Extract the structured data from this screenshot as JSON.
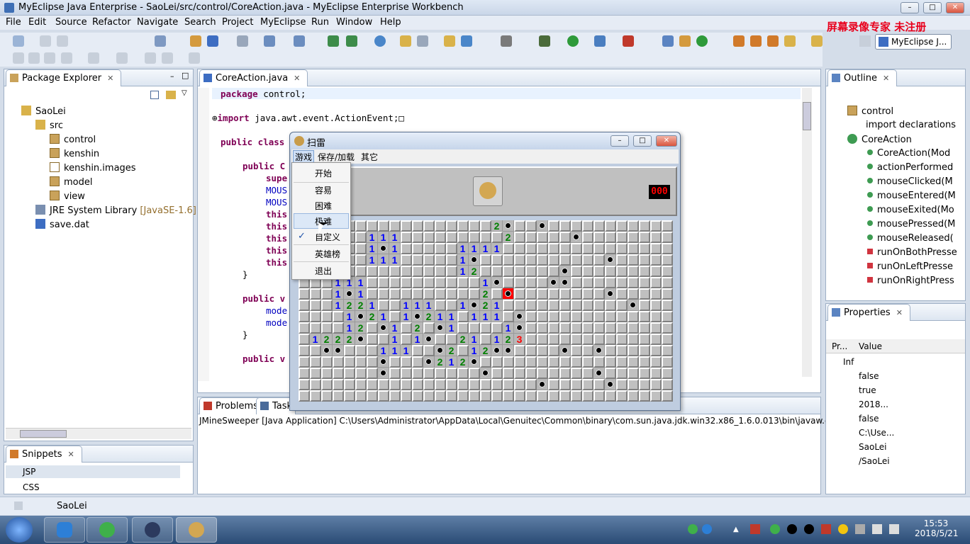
{
  "window": {
    "title": "MyEclipse Java Enterprise - SaoLei/src/control/CoreAction.java - MyEclipse Enterprise Workbench"
  },
  "watermark": "屏幕录像专家 未注册",
  "menubar": [
    "File",
    "Edit",
    "Source",
    "Refactor",
    "Navigate",
    "Search",
    "Project",
    "MyEclipse",
    "Run",
    "Window",
    "Help"
  ],
  "perspective": {
    "label": "MyEclipse J..."
  },
  "package_explorer": {
    "title": "Package Explorer",
    "project": "SaoLei",
    "src": "src",
    "packages": [
      "control",
      "kenshin",
      "kenshin.images",
      "model",
      "view"
    ],
    "jre": "JRE System Library",
    "jre_version": "[JavaSE-1.6]",
    "file": "save.dat"
  },
  "editor": {
    "tab": "CoreAction.java",
    "lines": {
      "package_kw": "package",
      "package_rest": " control;",
      "import_kw": "import",
      "import_rest": " java.awt.event.ActionEvent;",
      "class_kw": "public class",
      "ctor": "public C",
      "super_": "supe",
      "mous1": "MOUS",
      "mous2": "MOUS",
      "this1": "this",
      "this2": "this",
      "this3": "this",
      "this4": "this",
      "this5": "this",
      "brace1": "}",
      "pubv1": "public v",
      "mode1": "mode",
      "mode2": "mode",
      "brace2": "}",
      "pubv2": "public v"
    }
  },
  "outline": {
    "title": "Outline",
    "items": [
      "control",
      "import declarations",
      "CoreAction",
      "CoreAction(Mod",
      "actionPerformed",
      "mouseClicked(M",
      "mouseEntered(M",
      "mouseExited(Mo",
      "mousePressed(M",
      "mouseReleased(",
      "runOnBothPresse",
      "runOnLeftPresse",
      "runOnRightPress"
    ]
  },
  "properties": {
    "title": "Properties",
    "col_property": "Pr...",
    "col_value": "Value",
    "inf": "Inf",
    "values": [
      "false",
      "true",
      "2018...",
      "false",
      "C:\\Use...",
      "SaoLei",
      "/SaoLei"
    ]
  },
  "snippets": {
    "title": "Snippets",
    "items": [
      "JSP",
      "CSS"
    ]
  },
  "console": {
    "tabs": [
      "Problems",
      "Task"
    ],
    "text": "JMineSweeper [Java Application] C:\\Users\\Administrator\\AppData\\Local\\Genuitec\\Common\\binary\\com.sun.java.jdk.win32.x86_1.6.0.013\\bin\\javaw.exe ("
  },
  "minesweeper": {
    "title": "扫雷",
    "menu": [
      "游戏",
      "保存/加载",
      "其它"
    ],
    "counter": "000",
    "dropdown": [
      "开始",
      "容易",
      "困难",
      "极难",
      "自定义",
      "英雄榜",
      "退出"
    ],
    "checked_item": "自定义",
    "rows": [
      "ccccccccccccccccc2*cc*ccccccccccccc",
      "cccccc111ccccccccc2ccccc*cccccccccc",
      "cccccc1*1ccccc1111cccccccccccccccc",
      "cccccc111ccccc1*ccccccccccc*ccccccc",
      "cccccccccccccc12ccccccc*ccccccccc*",
      "ccc111cccccccccc1*cccc**cccccccccc",
      "ccc1*1cccccccccc2cXcccccccc*cccccc",
      "ccc1221cc111cc1*21ccccccccccc*cccc",
      "cccc1*21c1*211c111c*ccccccccccccccc",
      "cccc12c*1c2c*1cccc1*cccccccccccccc",
      "c1222*cc1c1*cc21c123ccccccccccccccc",
      "cc**ccc111cc*2c12**cccc*cc*cccccccc",
      "ccccccc*ccc*212*ccccccccccccccccccc",
      "ccccccc*cccccccc*ccccccccc*cccccccc",
      "ccccccccccccccccccccc*ccccc*ccccccc",
      "ccccccccccccccccccccccccccccccccccc"
    ]
  },
  "status": {
    "selection": "SaoLei"
  },
  "taskbar": {
    "time": "15:53",
    "date": "2018/5/21"
  },
  "colors": {
    "n1": "#0000ff",
    "n2": "#008000",
    "n3": "#ff0000",
    "mine_hit": "#ff0000"
  }
}
